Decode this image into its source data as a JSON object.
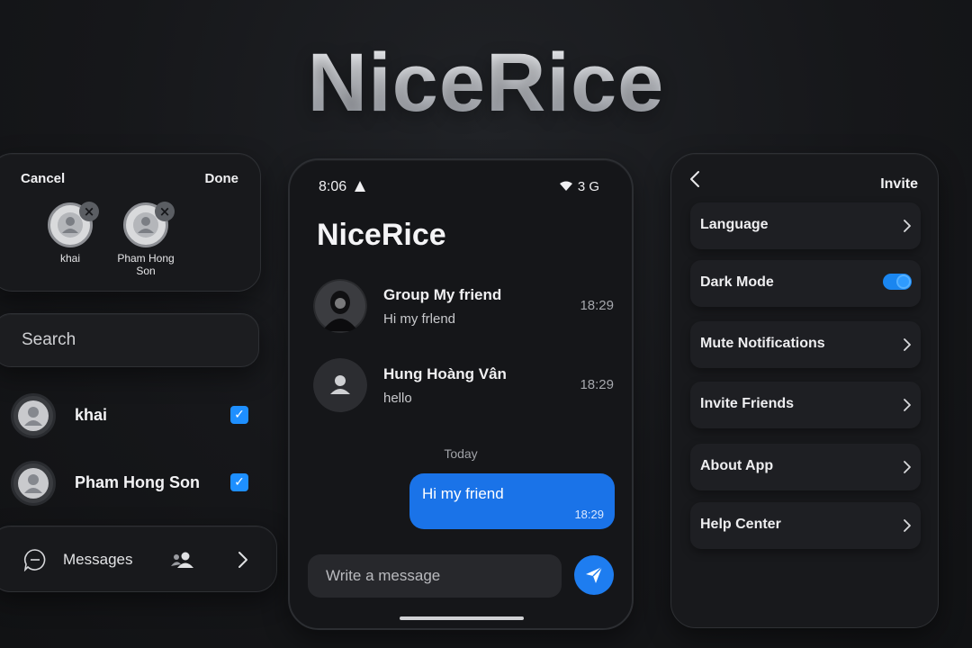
{
  "app_title": "NiceRice",
  "selection": {
    "cancel_label": "Cancel",
    "done_label": "Done",
    "chips": [
      {
        "label": "khai"
      },
      {
        "label": "Pham Hong Son"
      }
    ],
    "remove_glyph": "×"
  },
  "search": {
    "placeholder": "Search"
  },
  "contacts": [
    {
      "name": "khai",
      "checked": true
    },
    {
      "name": "Pham Hong Son",
      "checked": true
    }
  ],
  "bottom_bar": {
    "messages_label": "Messages"
  },
  "phone": {
    "status_time": "8:06",
    "status_network": "3 G",
    "title": "NiceRice",
    "chats": [
      {
        "name": "Group My friend",
        "preview": "Hi my frlend",
        "time": "18:29",
        "avatar": "photo"
      },
      {
        "name": "Hung Hoàng Vân",
        "preview": "hello",
        "time": "18:29",
        "avatar": "default-person-icon"
      }
    ],
    "day_separator": "Today",
    "outgoing_message": {
      "text": "Hi my friend",
      "time": "18:29"
    },
    "composer_placeholder": "Write a message"
  },
  "settings": {
    "header_action": "Invite",
    "items": [
      {
        "label": "Language",
        "control": "chevron"
      },
      {
        "label": "Dark Mode",
        "control": "toggle",
        "enabled": true
      },
      {
        "label": "Mute Notifications",
        "control": "chevron"
      },
      {
        "label": "Invite Friends",
        "control": "chevron"
      },
      {
        "label": "About App",
        "control": "chevron"
      },
      {
        "label": "Help Center",
        "control": "chevron"
      }
    ]
  },
  "colors": {
    "background": "#16171a",
    "accent": "#1a73e8",
    "checkbox": "#1e8fff"
  }
}
